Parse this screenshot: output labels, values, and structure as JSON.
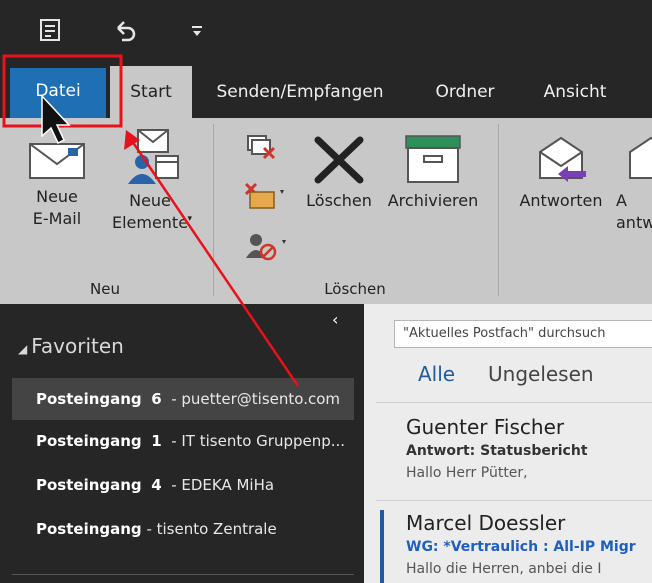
{
  "quick_access": {
    "buttons": [
      "send-receive-icon",
      "undo-icon",
      "customize-qat-icon"
    ]
  },
  "tabs": [
    {
      "label": "Datei"
    },
    {
      "label": "Start"
    },
    {
      "label": "Senden/Empfangen"
    },
    {
      "label": "Ordner"
    },
    {
      "label": "Ansicht"
    }
  ],
  "ribbon": {
    "neu": {
      "new_email": "Neue\nE-Mail",
      "new_items": "Neue\nElemente",
      "group_label": "Neu"
    },
    "loeschen": {
      "delete": "Löschen",
      "archive": "Archivieren",
      "group_label": "Löschen"
    },
    "antworten": {
      "reply": "Antworten",
      "reply_all_partial": "A\nantw"
    }
  },
  "navigation": {
    "favorites_header": "Favoriten",
    "items": [
      {
        "name": "Posteingang",
        "count": "6",
        "account": "- puetter@tisento.com"
      },
      {
        "name": "Posteingang",
        "count": "1",
        "account": "- IT tisento Gruppenp..."
      },
      {
        "name": "Posteingang",
        "count": "4",
        "account": "- EDEKA MiHa"
      },
      {
        "name": "Posteingang",
        "count": "",
        "account": "- tisento Zentrale"
      }
    ]
  },
  "mail_list": {
    "search_placeholder": "\"Aktuelles Postfach\" durchsuch",
    "filter_all": "Alle",
    "filter_unread": "Ungelesen",
    "messages": [
      {
        "from": "Guenter Fischer",
        "subject": "Antwort: Statusbericht",
        "preview": "Hallo Herr Pütter,"
      },
      {
        "from": "Marcel Doessler",
        "subject": "WG: *Vertraulich : All-IP Migr",
        "preview": "Hallo die Herren,  anbei die I"
      }
    ]
  },
  "colors": {
    "file_tab": "#1f6fb5",
    "annotation_red": "#e8121c",
    "dark_bg": "#262626",
    "ribbon_bg": "#c8c8c8"
  }
}
